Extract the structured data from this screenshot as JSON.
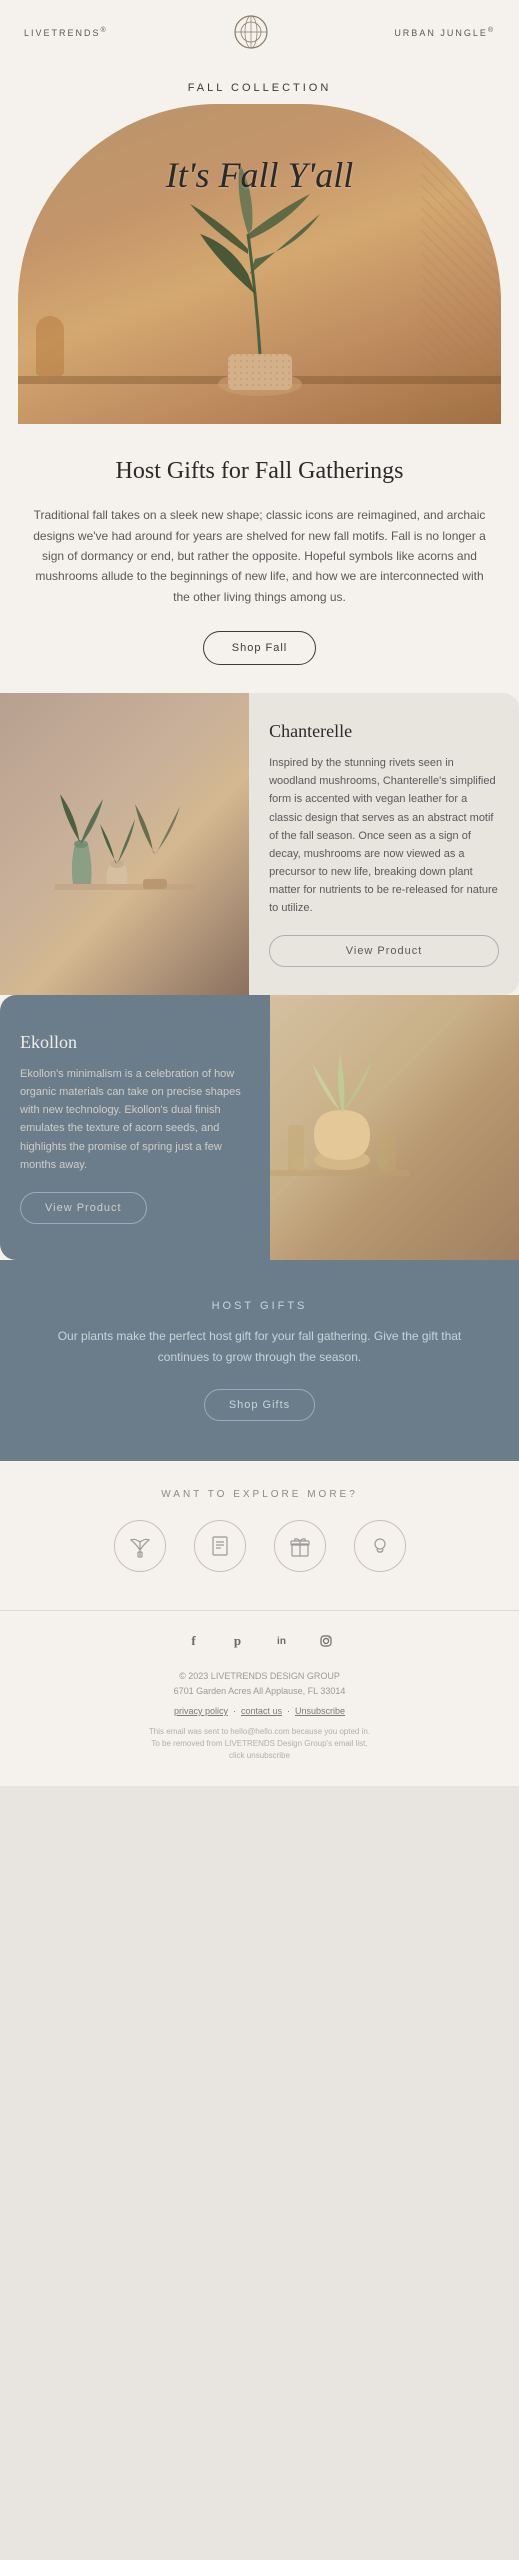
{
  "header": {
    "brand_left": "LIVETRENDS",
    "brand_right": "URBAN JUNGLE",
    "reg_symbol": "®"
  },
  "hero": {
    "section_label": "FALL COLLECTION",
    "title": "It's Fall Y'all"
  },
  "intro": {
    "heading": "Host Gifts for Fall Gatherings",
    "body": "Traditional fall takes on a sleek new shape; classic icons are reimagined, and archaic designs we've had around for years are shelved for new fall motifs. Fall is no longer a sign of dormancy or end, but rather the opposite. Hopeful symbols like acorns and mushrooms allude to the beginnings of new life, and how we are interconnected with the other living things among us.",
    "cta_label": "Shop Fall"
  },
  "product1": {
    "name": "Chanterelle",
    "description": "Inspired by the stunning rivets seen in woodland mushrooms, Chanterelle's simplified form is accented with vegan leather for a classic design that serves as an abstract motif of the fall season.\n\nOnce seen as a sign of decay, mushrooms are now viewed as a precursor to new life, breaking down plant matter for nutrients to be re-released for nature to utilize.",
    "cta_label": "View Product"
  },
  "product2": {
    "name": "Ekollon",
    "description": "Ekollon's minimalism is a celebration of how organic materials can take on precise shapes with new technology. Ekollon's dual finish emulates the texture of acorn seeds, and highlights the promise of spring just a few months away.",
    "cta_label": "View Product"
  },
  "host_gifts": {
    "section_label": "HOST GIFTS",
    "body": "Our plants make the perfect host gift for your fall gathering. Give the gift that continues to grow through the season.",
    "cta_label": "Shop Gifts"
  },
  "explore": {
    "label": "WANT TO EXPLORE MORE?",
    "icons": [
      {
        "name": "plant-icon",
        "symbol": "🪴"
      },
      {
        "name": "catalog-icon",
        "symbol": "📋"
      },
      {
        "name": "gift-icon",
        "symbol": "🎁"
      },
      {
        "name": "idea-icon",
        "symbol": "💡"
      }
    ]
  },
  "social": {
    "icons": [
      {
        "name": "facebook-icon",
        "symbol": "f"
      },
      {
        "name": "pinterest-icon",
        "symbol": "p"
      },
      {
        "name": "linkedin-icon",
        "symbol": "in"
      },
      {
        "name": "instagram-icon",
        "symbol": "◻"
      }
    ]
  },
  "footer": {
    "company": "© 2023 LIVETRENDS DESIGN GROUP",
    "address": "6701 Garden Acres All Applause, FL 33014",
    "privacy": "privacy policy",
    "contact": "contact us",
    "unsubscribe": "Unsubscribe",
    "disclaimer_1": "This email was sent to hello@hello.com because you opted in.",
    "disclaimer_2": "To be removed from LIVETRENDS Design Group's email list,",
    "disclaimer_3": "click unsubscribe"
  }
}
